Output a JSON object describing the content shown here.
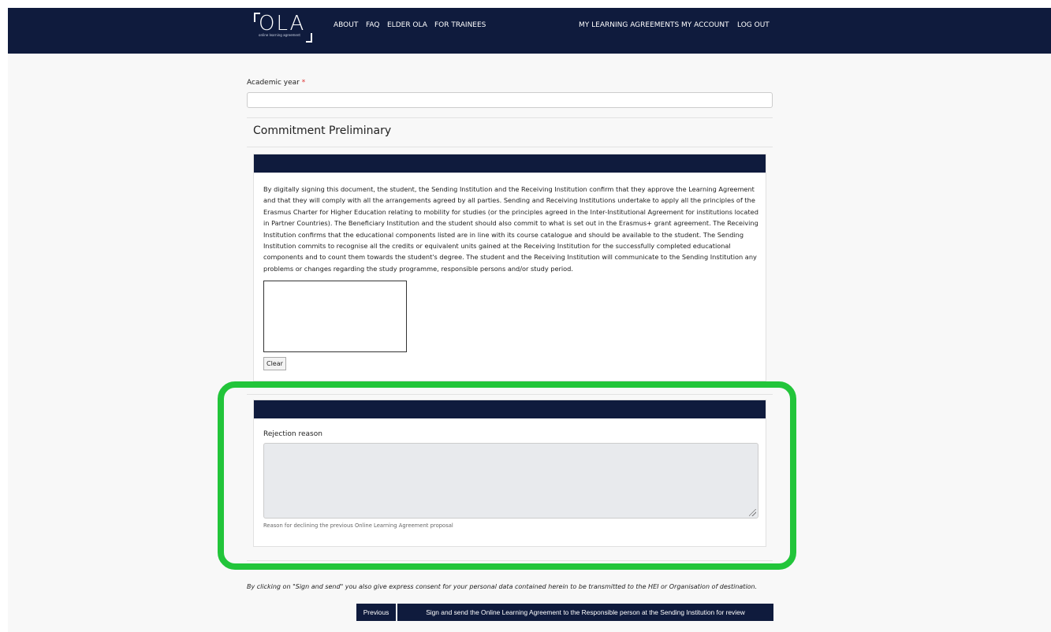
{
  "header": {
    "logo_text": "OLA",
    "logo_tagline": "online learning agreement",
    "nav_left": [
      "ABOUT",
      "FAQ",
      "ELDER OLA",
      "FOR TRAINEES"
    ],
    "nav_right": [
      "MY LEARNING AGREEMENTS",
      "MY ACCOUNT",
      "LOG OUT"
    ]
  },
  "form": {
    "academic_year_label": "Academic year",
    "required_marker": "*",
    "academic_year_value": "",
    "section_title": "Commitment Preliminary",
    "commitment_text": "By digitally signing this document, the student, the Sending Institution and the Receiving Institution confirm that they approve the Learning Agreement and that they will comply with all the arrangements agreed by all parties. Sending and Receiving Institutions undertake to apply all the principles of the Erasmus Charter for Higher Education relating to mobility for studies (or the principles agreed in the Inter-Institutional Agreement for institutions located in Partner Countries). The Beneficiary Institution and the student should also commit to what is set out in the Erasmus+ grant agreement. The Receiving Institution confirms that the educational components listed are in line with its course catalogue and should be available to the student. The Sending Institution commits to recognise all the credits or equivalent units gained at the Receiving Institution for the successfully completed educational components and to count them towards the student's degree. The student and the Receiving Institution will communicate to the Sending Institution any problems or changes regarding the study programme, responsible persons and/or study period.",
    "clear_label": "Clear",
    "rejection_label": "Rejection reason",
    "rejection_value": "",
    "rejection_help": "Reason for declining the previous Online Learning Agreement proposal",
    "consent_text": "By clicking on \"Sign and send\" you also give express consent for your personal data contained herein to be transmitted to the HEI or Organisation of destination.",
    "previous_label": "Previous",
    "submit_label": "Sign and send the Online Learning Agreement to the Responsible person at the Sending Institution for review"
  },
  "colors": {
    "navy": "#0f1b3d",
    "highlight": "#22c53a",
    "disabled_field": "#e8eaed"
  }
}
